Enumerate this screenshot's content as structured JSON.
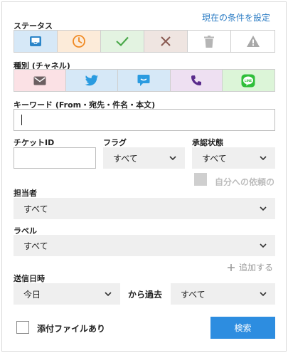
{
  "header": {
    "reset_link": "現在の条件を設定"
  },
  "status": {
    "label": "ステータス",
    "items": [
      {
        "name": "inbox",
        "bg": "#d6e8f7",
        "color": "#2b85c9"
      },
      {
        "name": "clock",
        "bg": "#fcebd9",
        "color": "#f08a24"
      },
      {
        "name": "check",
        "bg": "#e3f3e1",
        "color": "#4aa84a"
      },
      {
        "name": "cross",
        "bg": "#efe5e1",
        "color": "#8a5a52"
      },
      {
        "name": "trash",
        "bg": "#ffffff",
        "color": "#b5b5b5"
      },
      {
        "name": "warning",
        "bg": "#ffffff",
        "color": "#a8a8a8"
      }
    ]
  },
  "channel": {
    "label": "種別 (チャネル)",
    "items": [
      {
        "name": "mail",
        "bg": "#fbe1e5",
        "color": "#6b5f61"
      },
      {
        "name": "twitter",
        "bg": "#d6e8f7",
        "color": "#2a9be0"
      },
      {
        "name": "chat",
        "bg": "#d6e8f7",
        "color": "#2a9be0"
      },
      {
        "name": "phone",
        "bg": "#eee0f2",
        "color": "#5a2b8c"
      },
      {
        "name": "line",
        "bg": "#dcf5d8",
        "color": "#2fbf3a"
      }
    ]
  },
  "keyword": {
    "label": "キーワード (From・宛先・件名・本文)",
    "value": ""
  },
  "ticket_id": {
    "label": "チケットID",
    "value": ""
  },
  "flag": {
    "label": "フラグ",
    "value": "すべて"
  },
  "approval": {
    "label": "承認状態",
    "value": "すべて"
  },
  "self_request": {
    "label": "自分への依頼の"
  },
  "assignee": {
    "label": "担当者",
    "value": "すべて"
  },
  "label_field": {
    "label": "ラベル",
    "value": "すべて"
  },
  "add_link": "追加する",
  "sent_date": {
    "label": "送信日時",
    "from_value": "今日",
    "connector": "から過去",
    "to_value": "すべて"
  },
  "attachment": {
    "label": "添付ファイルあり"
  },
  "search_button": "検索"
}
